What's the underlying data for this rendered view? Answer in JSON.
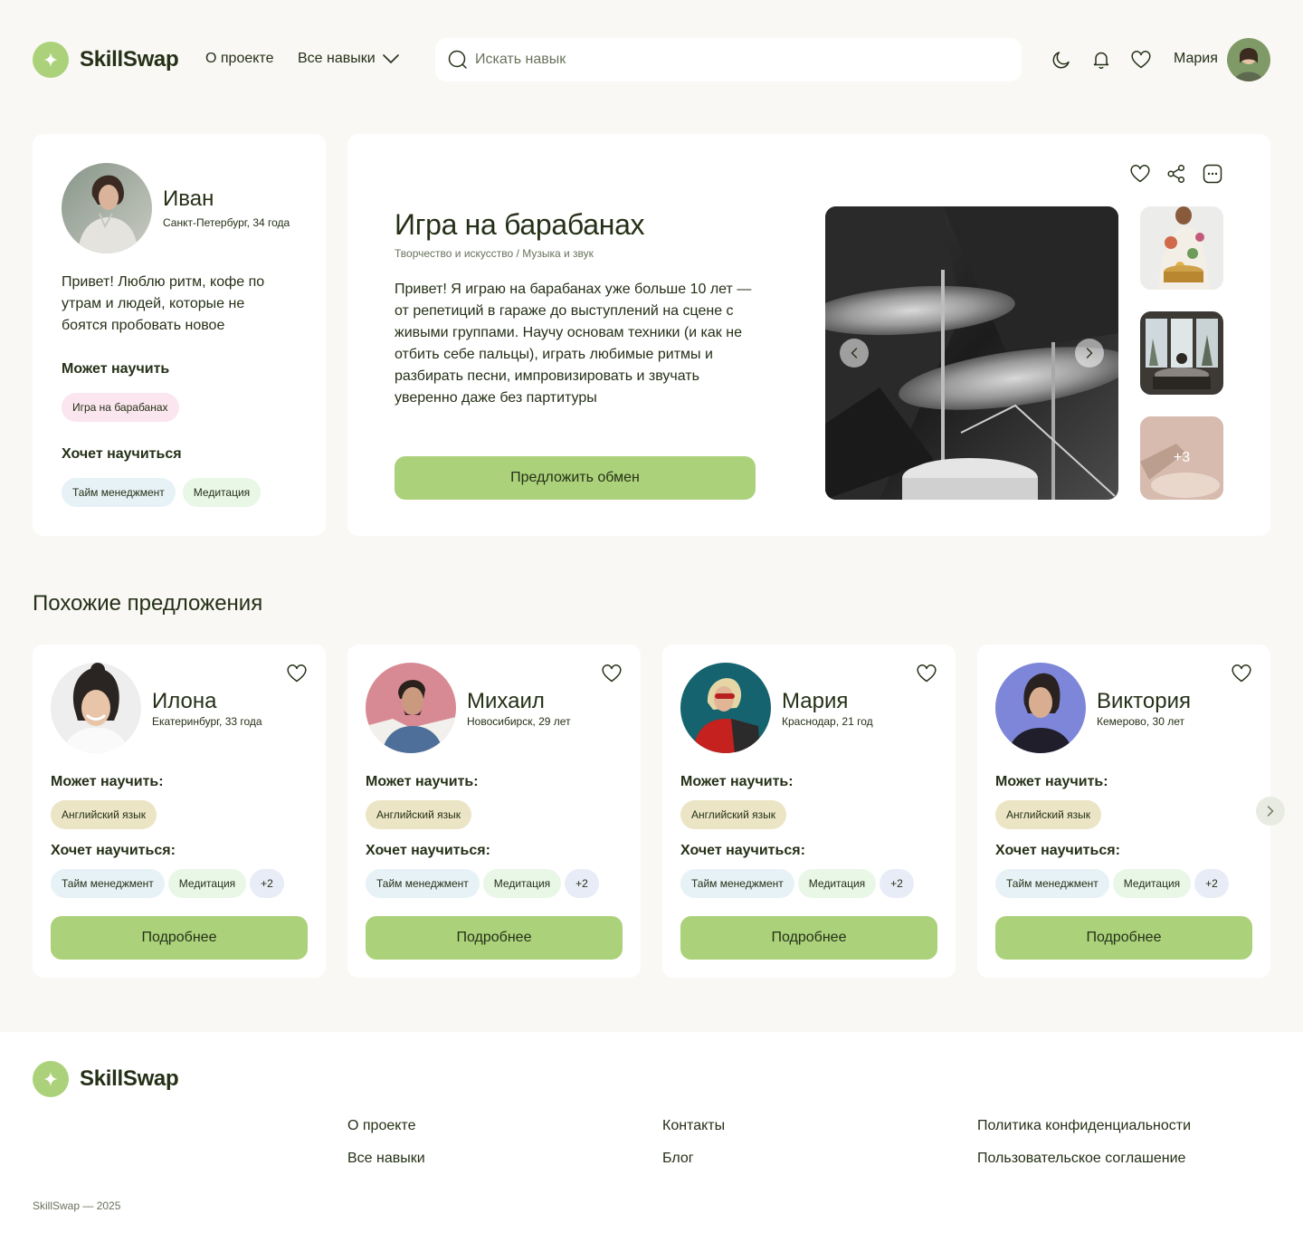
{
  "header": {
    "logo": "SkillSwap",
    "nav_about": "О проекте",
    "nav_skills": "Все навыки",
    "search_placeholder": "Искать навык",
    "user_name": "Мария"
  },
  "profile": {
    "name": "Иван",
    "location": "Санкт-Петербург, 34 года",
    "about": "Привет! Люблю ритм, кофе по утрам и людей, которые не боятся пробовать новое",
    "can_teach_label": "Может научить",
    "can_teach": [
      "Игра на барабанах"
    ],
    "wants_label": "Хочет научиться",
    "wants": [
      "Тайм менеджмент",
      "Медитация"
    ]
  },
  "skill": {
    "title": "Игра на барабанах",
    "breadcrumbs": "Творчество и искусство / Музыка и звук",
    "description": "Привет! Я играю на барабанах уже больше 10 лет — от репетиций в гараже до выступлений на сцене с живыми группами. Научу основам техники (и как не отбить себе пальцы), играть любимые ритмы и разбирать песни, импровизировать и звучать уверенно даже без партитуры",
    "cta": "Предложить обмен",
    "more_photos": "+3"
  },
  "similar": {
    "title": "Похожие предложения",
    "can_teach_label": "Может научить:",
    "wants_label": "Хочет научиться:",
    "details_label": "Подробнее",
    "cards": [
      {
        "name": "Илона",
        "location": "Екатеринбург, 33 года",
        "teach": "Английский язык",
        "want1": "Тайм менеджмент",
        "want2": "Медитация",
        "more": "+2"
      },
      {
        "name": "Михаил",
        "location": "Новосибирск, 29 лет",
        "teach": "Английский язык",
        "want1": "Тайм менеджмент",
        "want2": "Медитация",
        "more": "+2"
      },
      {
        "name": "Мария",
        "location": "Краснодар, 21 год",
        "teach": "Английский язык",
        "want1": "Тайм менеджмент",
        "want2": "Медитация",
        "more": "+2"
      },
      {
        "name": "Виктория",
        "location": "Кемерово, 30 лет",
        "teach": "Английский язык",
        "want1": "Тайм менеджмент",
        "want2": "Медитация",
        "more": "+2"
      }
    ]
  },
  "footer": {
    "logo": "SkillSwap",
    "links": {
      "about": "О проекте",
      "skills": "Все навыки",
      "contacts": "Контакты",
      "blog": "Блог",
      "privacy": "Политика конфиденциальности",
      "terms": "Пользовательское соглашение"
    },
    "copyright": "SkillSwap — 2025"
  },
  "colors": {
    "accent": "#abd27a",
    "text": "#253017",
    "background": "#f9f8f5"
  }
}
